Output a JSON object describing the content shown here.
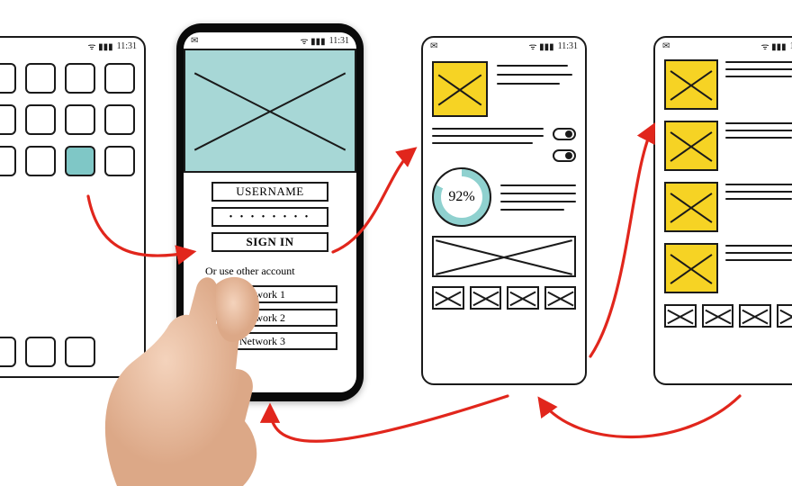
{
  "statusbar": {
    "time": "11:31",
    "signal": "ᯤ ▮▮▮"
  },
  "signin": {
    "username_label": "USERNAME",
    "password_masked": "• • • • • • • •",
    "signin_label": "SIGN IN",
    "or_text": "Or use other account",
    "social1": "Social Network 1",
    "social2": "Social Network 2",
    "social3": "Social Network 3"
  },
  "dashboard": {
    "gauge_percent": "92%"
  },
  "colors": {
    "teal": "#a7d7d6",
    "yellow": "#f6d324",
    "ink": "#1a1a1a",
    "arrow": "#e1261c"
  }
}
